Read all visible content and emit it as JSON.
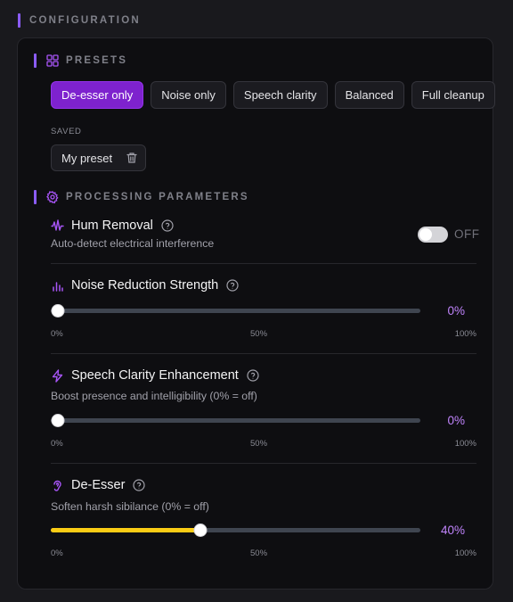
{
  "section_title": "CONFIGURATION",
  "presets_title": "PRESETS",
  "presets": [
    {
      "label": "De-esser only",
      "active": true
    },
    {
      "label": "Noise only",
      "active": false
    },
    {
      "label": "Speech clarity",
      "active": false
    },
    {
      "label": "Balanced",
      "active": false
    },
    {
      "label": "Full cleanup",
      "active": false
    }
  ],
  "saved": {
    "label": "SAVED",
    "items": [
      {
        "name": "My preset"
      }
    ]
  },
  "processing_title": "PROCESSING PARAMETERS",
  "params": {
    "hum": {
      "name": "Hum Removal",
      "desc": "Auto-detect electrical interference",
      "toggle_state": "OFF",
      "enabled": false
    },
    "noise": {
      "name": "Noise Reduction Strength",
      "value": 0,
      "value_label": "0%"
    },
    "clarity": {
      "name": "Speech Clarity Enhancement",
      "desc": "Boost presence and intelligibility (0% = off)",
      "value": 0,
      "value_label": "0%"
    },
    "deesser": {
      "name": "De-Esser",
      "desc": "Soften harsh sibilance (0% = off)",
      "value": 40,
      "value_label": "40%"
    }
  },
  "scale_ticks": [
    "0%",
    "50%",
    "100%"
  ],
  "colors": {
    "accent": "#8b5cf6",
    "active_preset": "#7e22ce",
    "value_text": "#c084fc",
    "slider_fill": "#facc15"
  },
  "icons": {
    "presets": "grid-icon",
    "processing": "gear-icon",
    "hum": "waveform-icon",
    "noise": "bar-chart-icon",
    "clarity": "lightning-icon",
    "deesser": "ear-icon",
    "help": "help-circle-icon",
    "delete": "trash-icon"
  }
}
